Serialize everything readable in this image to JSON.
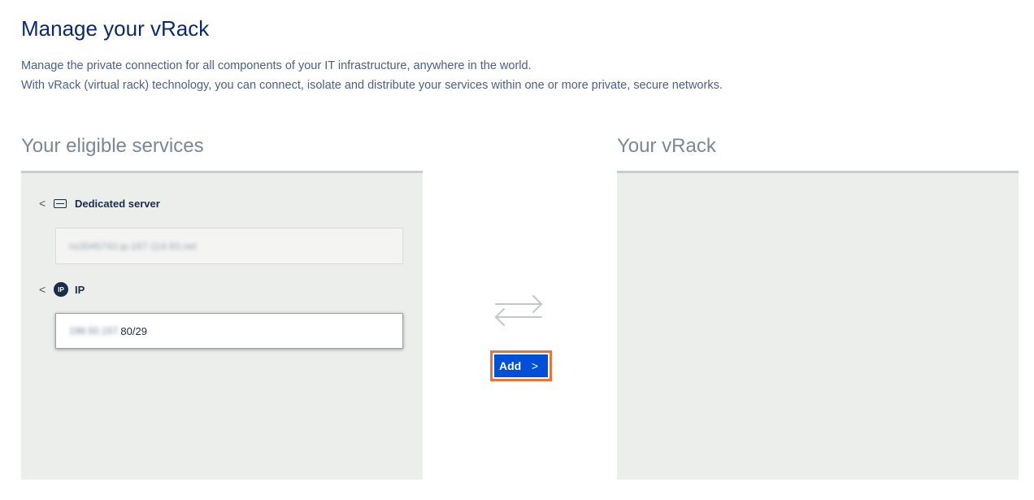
{
  "header": {
    "title": "Manage your vRack",
    "description_line1": "Manage the private connection for all components of your IT infrastructure, anywhere in the world.",
    "description_line2": "With vRack (virtual rack) technology, you can connect, isolate and distribute your services within one or more private, secure networks."
  },
  "eligible": {
    "heading": "Your eligible services",
    "groups": [
      {
        "label": "Dedicated server",
        "icon": "server-icon",
        "items": [
          "ns3045743.ip-167-114-93.net"
        ]
      },
      {
        "label": "IP",
        "icon": "ip-icon",
        "icon_text": "IP",
        "items": [
          {
            "masked_prefix": "198.50.157.",
            "visible_suffix": "80/29"
          }
        ]
      }
    ]
  },
  "actions": {
    "swap_icon": "swap-arrows-icon",
    "add_label": "Add",
    "add_icon": "chevron-right-icon"
  },
  "vrack": {
    "heading": "Your vRack"
  },
  "colors": {
    "title": "#0b2a6b",
    "primary_button": "#0050d7",
    "highlight_outline": "#e8743b",
    "panel_bg": "#eceeec"
  }
}
